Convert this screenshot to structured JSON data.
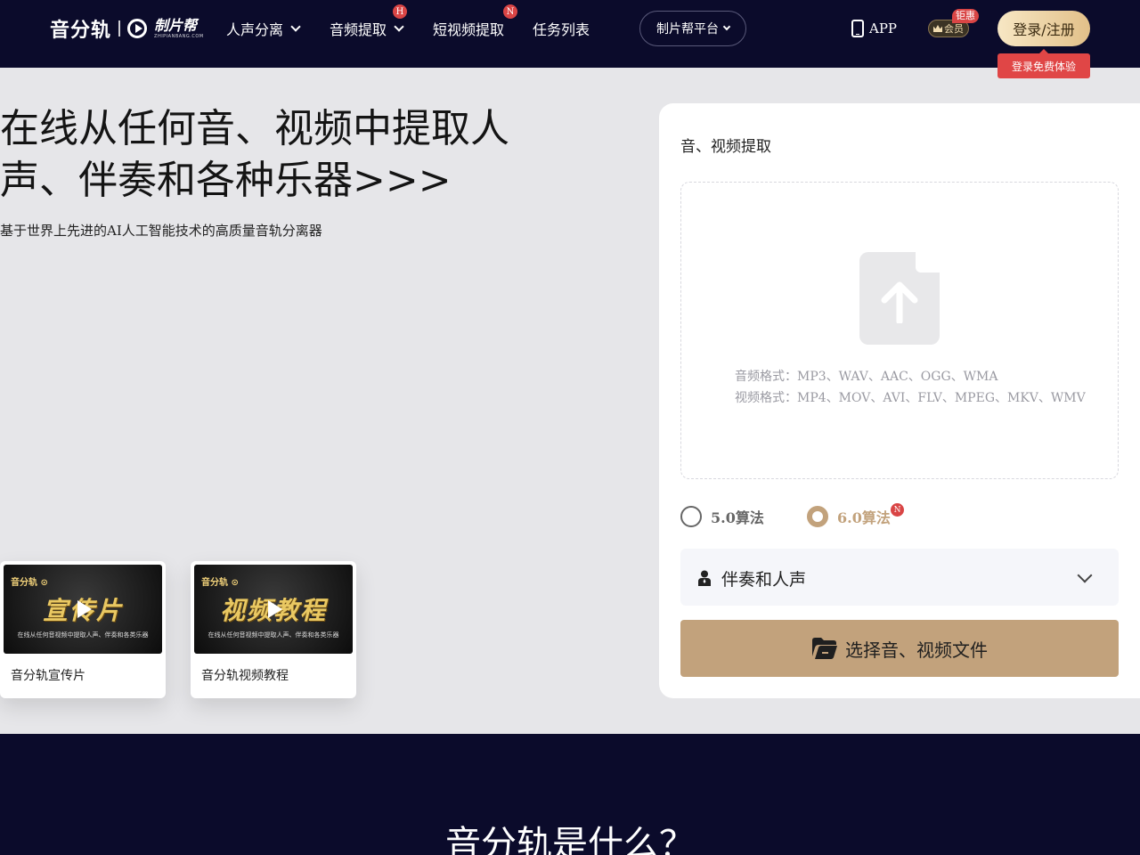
{
  "header": {
    "logo_text": "音分轨",
    "logo_sub_main": "制片帮",
    "logo_sub_small": "ZHIPIANBANG.COM",
    "nav": [
      {
        "label": "人声分离",
        "has_dropdown": true
      },
      {
        "label": "音频提取",
        "has_dropdown": true,
        "badge": "H"
      },
      {
        "label": "短视频提取",
        "badge": "N"
      },
      {
        "label": "任务列表"
      }
    ],
    "platform_label": "制片帮平台",
    "app_label": "APP",
    "vip_label": "会员",
    "vip_tag": "钜惠",
    "login_label": "登录/注册",
    "login_tip": "登录免费体验",
    "badge_color": "#d94545"
  },
  "hero": {
    "title": "在线从任何音、视频中提取人声、伴奏和各种乐器>>>",
    "subtitle": "基于世界上先进的AI人工智能技术的高质量音轨分离器"
  },
  "videos": [
    {
      "thumb_logo": "音分轨 ⊙",
      "thumb_title": "宣传片",
      "thumb_line": "在线从任何音视频中提取人声、伴奏和各类乐器",
      "caption": "音分轨宣传片"
    },
    {
      "thumb_logo": "音分轨 ⊙",
      "thumb_title": "视频教程",
      "thumb_line": "在线从任何音视频中提取人声、伴奏和各类乐器",
      "caption": "音分轨视频教程"
    }
  ],
  "panel": {
    "title": "音、视频提取",
    "audio_formats": "音频格式：MP3、WAV、AAC、OGG、WMA",
    "video_formats": "视频格式：MP4、MOV、AVI、FLV、MPEG、MKV、WMV",
    "algorithms": [
      {
        "label": "5.0算法",
        "selected": false
      },
      {
        "label": "6.0算法",
        "selected": true,
        "badge": "N"
      }
    ],
    "mode_selected": "伴奏和人声",
    "choose_label": "选择音、视频文件",
    "accent_color": "#c2a27c"
  },
  "bottom": {
    "title": "音分轨是什么？"
  }
}
